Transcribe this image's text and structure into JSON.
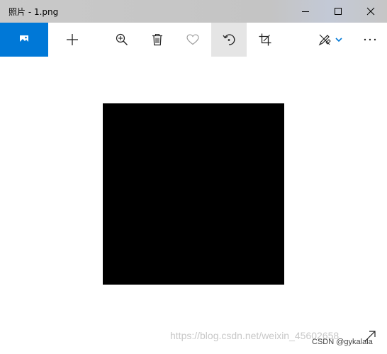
{
  "window": {
    "title": "照片 - 1.png"
  },
  "window_controls": {
    "minimize_icon": "minimize-icon",
    "maximize_icon": "maximize-icon",
    "close_icon": "close-icon"
  },
  "toolbar": {
    "items": [
      {
        "name": "photo-icon",
        "icon": "picture"
      },
      {
        "name": "add-icon",
        "icon": "plus"
      },
      {
        "name": "zoom-in-icon",
        "icon": "magnifier-plus"
      },
      {
        "name": "delete-icon",
        "icon": "trash"
      },
      {
        "name": "favorite-icon",
        "icon": "heart"
      },
      {
        "name": "rotate-icon",
        "icon": "rotate"
      },
      {
        "name": "crop-icon",
        "icon": "crop"
      },
      {
        "name": "edit-draw-icon",
        "icon": "pen-tools"
      },
      {
        "name": "more-icon",
        "icon": "ellipsis"
      }
    ],
    "accent_color": "#0078d7",
    "active_item": "rotate-icon"
  },
  "image": {
    "fill_color": "#000000"
  },
  "footer": {
    "watermark": "https://blog.csdn.net/weixin_45602658",
    "credit": "CSDN @gykalala"
  }
}
